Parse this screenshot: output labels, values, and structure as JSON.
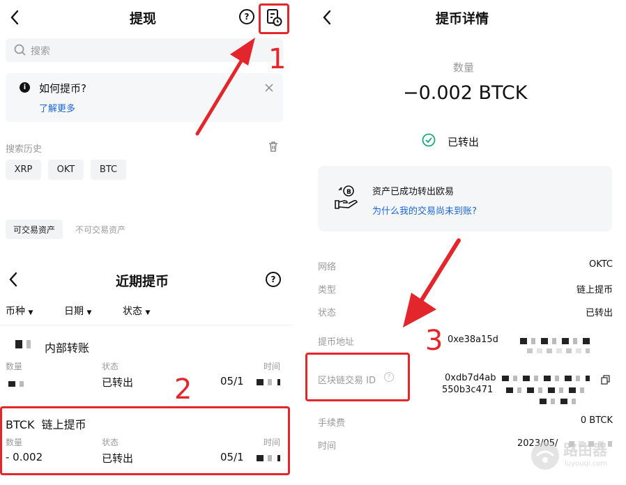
{
  "withdraw": {
    "title": "提现",
    "search_placeholder": "搜索",
    "help_card": {
      "title": "如何提币?",
      "link": "了解更多"
    },
    "history_label": "搜索历史",
    "history_chips": [
      "XRP",
      "OKT",
      "BTC"
    ],
    "tabs": [
      "可交易资产",
      "不可交易资产"
    ]
  },
  "recent": {
    "title": "近期提币",
    "filters": [
      "币种",
      "日期",
      "状态"
    ],
    "records": [
      {
        "name": "内部转账",
        "qty_label": "数量",
        "status_label": "状态",
        "status": "已转出",
        "time_label": "时间",
        "date": "05/1"
      },
      {
        "name": "BTCK  链上提币",
        "qty_label": "数量",
        "qty": "- 0.002",
        "status_label": "状态",
        "status": "已转出",
        "time_label": "时间",
        "date": "05/1"
      }
    ]
  },
  "detail": {
    "title": "提币详情",
    "qty_label": "数量",
    "amount": "−0.002 BTCK",
    "status": "已转出",
    "notice_title": "资产已成功转出欧易",
    "notice_link": "为什么我的交易尚未到账?",
    "rows": [
      {
        "label": "网络",
        "value": "OKTC"
      },
      {
        "label": "类型",
        "value": "链上提币"
      },
      {
        "label": "状态",
        "value": "已转出"
      },
      {
        "label": "提币地址",
        "value": "0xe38a15d"
      },
      {
        "label": "区块链交易 ID",
        "value1": "0xdb7d4ab",
        "value2": "550b3c471"
      },
      {
        "label": "手续费",
        "value": "0 BTCK"
      },
      {
        "label": "时间",
        "value": "2023/05/"
      }
    ]
  },
  "annotations": {
    "step1": "1",
    "step2": "2",
    "step3": "3"
  },
  "watermark": {
    "cn": "路由器",
    "en": "luyouqi.com"
  },
  "colors": {
    "accent": "#1a66d6",
    "red": "#e3262b",
    "green": "#19a97b"
  }
}
